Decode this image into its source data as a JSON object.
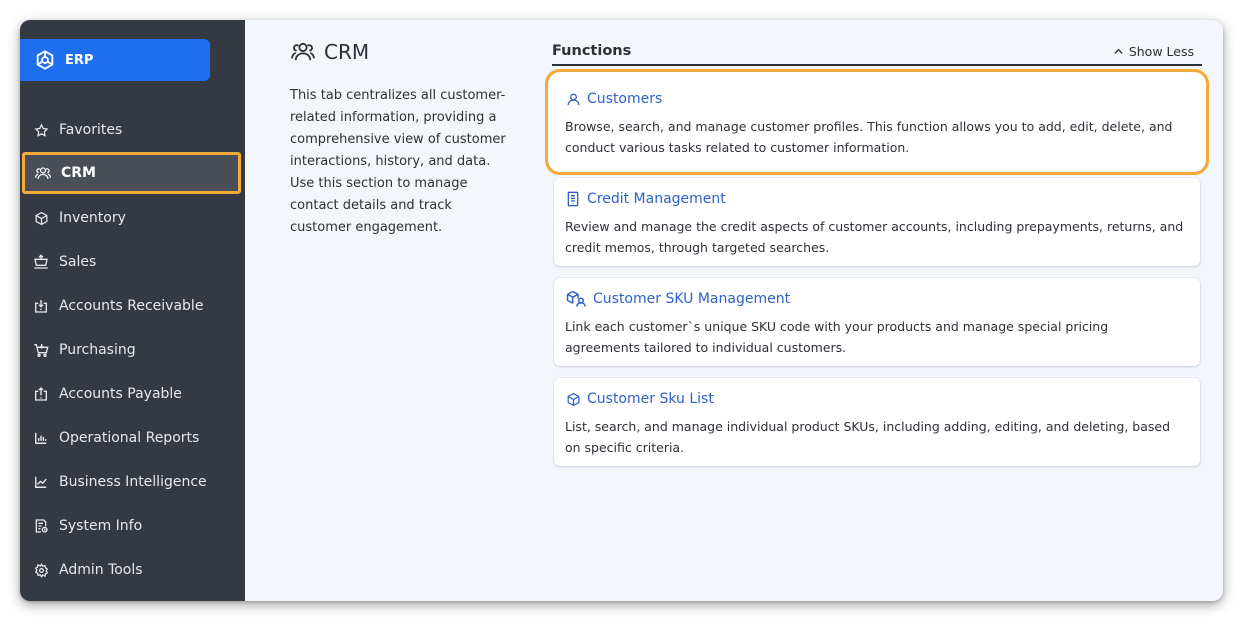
{
  "brand": {
    "label": "ERP",
    "icon": "erp-logo-icon"
  },
  "sidebar": {
    "items": [
      {
        "label": "Favorites",
        "icon": "star-icon"
      },
      {
        "label": "CRM",
        "icon": "people-icon",
        "active": true
      },
      {
        "label": "Inventory",
        "icon": "box-icon"
      },
      {
        "label": "Sales",
        "icon": "sales-icon"
      },
      {
        "label": "Accounts Receivable",
        "icon": "receive-icon"
      },
      {
        "label": "Purchasing",
        "icon": "cart-icon"
      },
      {
        "label": "Accounts Payable",
        "icon": "payable-icon"
      },
      {
        "label": "Operational Reports",
        "icon": "bar-chart-icon"
      },
      {
        "label": "Business Intelligence",
        "icon": "line-chart-icon"
      },
      {
        "label": "System Info",
        "icon": "document-clock-icon"
      },
      {
        "label": "Admin Tools",
        "icon": "gear-icon"
      }
    ]
  },
  "crm": {
    "title": "CRM",
    "description": "This tab centralizes all customer-related information, providing a comprehensive view of customer interactions, history, and data. Use this section to manage contact details and track customer engagement."
  },
  "functions": {
    "title": "Functions",
    "toggle_label": "Show Less",
    "cards": [
      {
        "title": "Customers",
        "icon": "person-icon",
        "description": "Browse, search, and manage customer profiles. This function allows you to add, edit, delete, and conduct various tasks related to customer information."
      },
      {
        "title": "Credit Management",
        "icon": "receipt-icon",
        "description": "Review and manage the credit aspects of customer accounts, including prepayments, returns, and credit memos, through targeted searches."
      },
      {
        "title": "Customer SKU Management",
        "icon": "box-person-icon",
        "description": "Link each customer`s unique SKU code with your products and manage special pricing agreements tailored to individual customers."
      },
      {
        "title": "Customer Sku List",
        "icon": "cube-icon",
        "description": "List, search, and manage individual product SKUs, including adding, editing, and deleting, based on specific criteria."
      }
    ]
  },
  "colors": {
    "sidebar": "#353a42",
    "brand": "#1e6ff0",
    "highlight": "#f4a93a",
    "link": "#2c62c9",
    "background": "#f3f6fb"
  }
}
